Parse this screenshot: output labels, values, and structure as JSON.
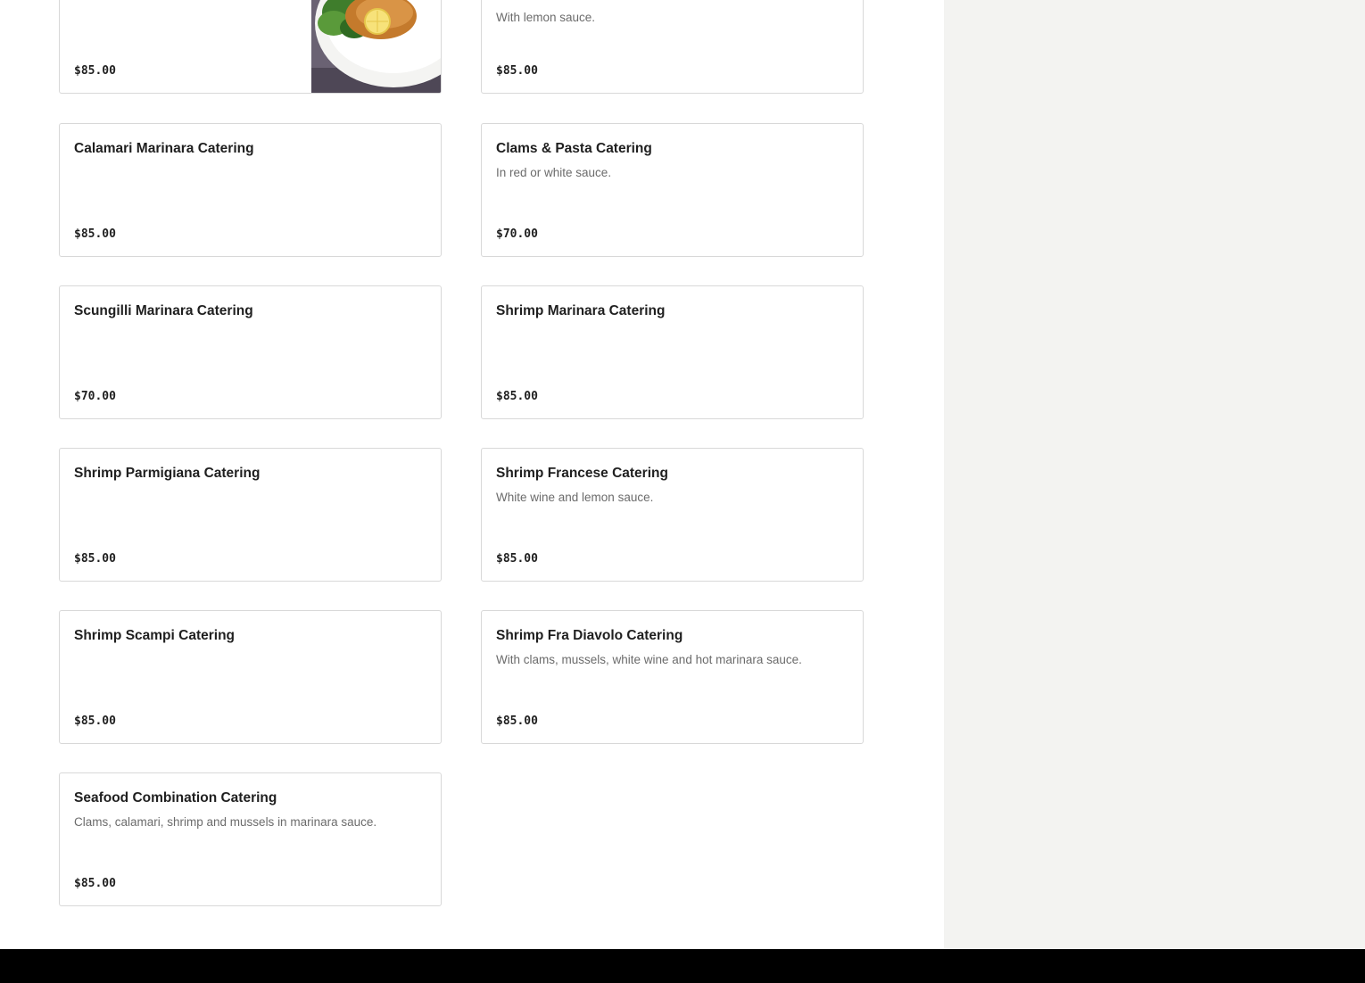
{
  "menu": {
    "items": [
      {
        "name": "",
        "description": "",
        "price": "$85.00",
        "has_image": true,
        "image_icon": "fish-francese-plate-photo"
      },
      {
        "name": "",
        "description": "With lemon sauce.",
        "price": "$85.00",
        "has_image": false
      },
      {
        "name": "Calamari Marinara Catering",
        "description": "",
        "price": "$85.00",
        "has_image": false
      },
      {
        "name": "Clams & Pasta Catering",
        "description": "In red or white sauce.",
        "price": "$70.00",
        "has_image": false
      },
      {
        "name": "Scungilli Marinara Catering",
        "description": "",
        "price": "$70.00",
        "has_image": false
      },
      {
        "name": "Shrimp Marinara Catering",
        "description": "",
        "price": "$85.00",
        "has_image": false
      },
      {
        "name": "Shrimp Parmigiana Catering",
        "description": "",
        "price": "$85.00",
        "has_image": false
      },
      {
        "name": "Shrimp Francese Catering",
        "description": "White wine and lemon sauce.",
        "price": "$85.00",
        "has_image": false
      },
      {
        "name": "Shrimp Scampi Catering",
        "description": "",
        "price": "$85.00",
        "has_image": false
      },
      {
        "name": "Shrimp Fra Diavolo Catering",
        "description": "With clams, mussels, white wine and hot marinara sauce.",
        "price": "$85.00",
        "has_image": false
      },
      {
        "name": "Seafood Combination Catering",
        "description": "Clams, calamari, shrimp and mussels in marinara sauce.",
        "price": "$85.00",
        "has_image": false
      }
    ]
  },
  "colors": {
    "side_panel": "#f3f3f1",
    "footer": "#000000",
    "card_border": "#d8d8d8",
    "title_text": "#1f1f1f",
    "desc_text": "#6b6b6b"
  }
}
